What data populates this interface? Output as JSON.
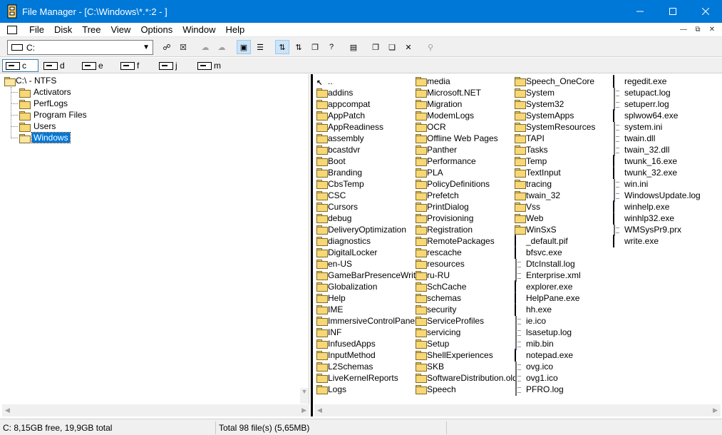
{
  "window": {
    "title": "File Manager - [C:\\Windows\\*.*:2 - ]"
  },
  "menu": [
    "File",
    "Disk",
    "Tree",
    "View",
    "Options",
    "Window",
    "Help"
  ],
  "toolbar": {
    "drive_value": "C:"
  },
  "drives": [
    "c",
    "d",
    "e",
    "f",
    "j",
    "m"
  ],
  "tree": {
    "root": "C:\\ - NTFS",
    "children": [
      "Activators",
      "PerfLogs",
      "Program Files",
      "Users",
      "Windows"
    ],
    "selected": "Windows"
  },
  "files": {
    "columns": [
      [
        "..",
        "addins",
        "appcompat",
        "AppPatch",
        "AppReadiness",
        "assembly",
        "bcastdvr",
        "Boot",
        "Branding",
        "CbsTemp",
        "CSC",
        "Cursors",
        "debug",
        "DeliveryOptimization",
        "diagnostics",
        "DigitalLocker",
        "en-US",
        "GameBarPresenceWriter",
        "Globalization",
        "Help",
        "IME",
        "ImmersiveControlPanel",
        "INF",
        "InfusedApps",
        "InputMethod",
        "L2Schemas",
        "LiveKernelReports",
        "Logs"
      ],
      [
        "media",
        "Microsoft.NET",
        "Migration",
        "ModemLogs",
        "OCR",
        "Offline Web Pages",
        "Panther",
        "Performance",
        "PLA",
        "PolicyDefinitions",
        "Prefetch",
        "PrintDialog",
        "Provisioning",
        "Registration",
        "RemotePackages",
        "rescache",
        "resources",
        "ru-RU",
        "SchCache",
        "schemas",
        "security",
        "ServiceProfiles",
        "servicing",
        "Setup",
        "ShellExperiences",
        "SKB",
        "SoftwareDistribution.old",
        "Speech"
      ],
      [
        "Speech_OneCore",
        "System",
        "System32",
        "SystemApps",
        "SystemResources",
        "TAPI",
        "Tasks",
        "Temp",
        "TextInput",
        "tracing",
        "twain_32",
        "Vss",
        "Web",
        "WinSxS",
        "_default.pif",
        "bfsvc.exe",
        "DtcInstall.log",
        "Enterprise.xml",
        "explorer.exe",
        "HelpPane.exe",
        "hh.exe",
        "ie.ico",
        "lsasetup.log",
        "mib.bin",
        "notepad.exe",
        "ovg.ico",
        "ovg1.ico",
        "PFRO.log"
      ],
      [
        "regedit.exe",
        "setupact.log",
        "setuperr.log",
        "splwow64.exe",
        "system.ini",
        "twain.dll",
        "twain_32.dll",
        "twunk_16.exe",
        "twunk_32.exe",
        "win.ini",
        "WindowsUpdate.log",
        "winhelp.exe",
        "winhlp32.exe",
        "WMSysPr9.prx",
        "write.exe"
      ]
    ],
    "types": [
      [
        "up",
        "folder",
        "folder",
        "folder",
        "folder",
        "folder",
        "folder",
        "folder",
        "folder",
        "folder",
        "folder",
        "folder",
        "folder",
        "folder",
        "folder",
        "folder",
        "folder",
        "folder",
        "folder",
        "folder",
        "folder",
        "folder",
        "folder",
        "folder",
        "folder",
        "folder",
        "folder",
        "folder"
      ],
      [
        "folder",
        "folder",
        "folder",
        "folder",
        "folder",
        "folder",
        "folder",
        "folder",
        "folder",
        "folder",
        "folder",
        "folder",
        "folder",
        "folder",
        "folder",
        "folder",
        "folder",
        "folder",
        "folder",
        "folder",
        "folder",
        "folder",
        "folder",
        "folder",
        "folder",
        "folder",
        "folder",
        "folder"
      ],
      [
        "folder",
        "folder",
        "folder",
        "folder",
        "folder",
        "folder",
        "folder",
        "folder",
        "folder",
        "folder",
        "folder",
        "folder",
        "folder",
        "folder",
        "exe",
        "exe",
        "doc",
        "doc",
        "exe",
        "exe",
        "exe",
        "doc",
        "doc",
        "doc",
        "exe",
        "doc",
        "doc",
        "doc"
      ],
      [
        "exe",
        "doc",
        "doc",
        "exe",
        "doc",
        "doc",
        "doc",
        "exe",
        "exe",
        "doc",
        "doc",
        "exe",
        "exe",
        "doc",
        "exe"
      ]
    ]
  },
  "status": {
    "free": "C: 8,15GB free,  19,9GB total",
    "total": "Total 98 file(s) (5,65MB)"
  },
  "colors": {
    "titlebar": "#0078d7",
    "folder": "#f8d775",
    "selection": "#0078d7"
  }
}
